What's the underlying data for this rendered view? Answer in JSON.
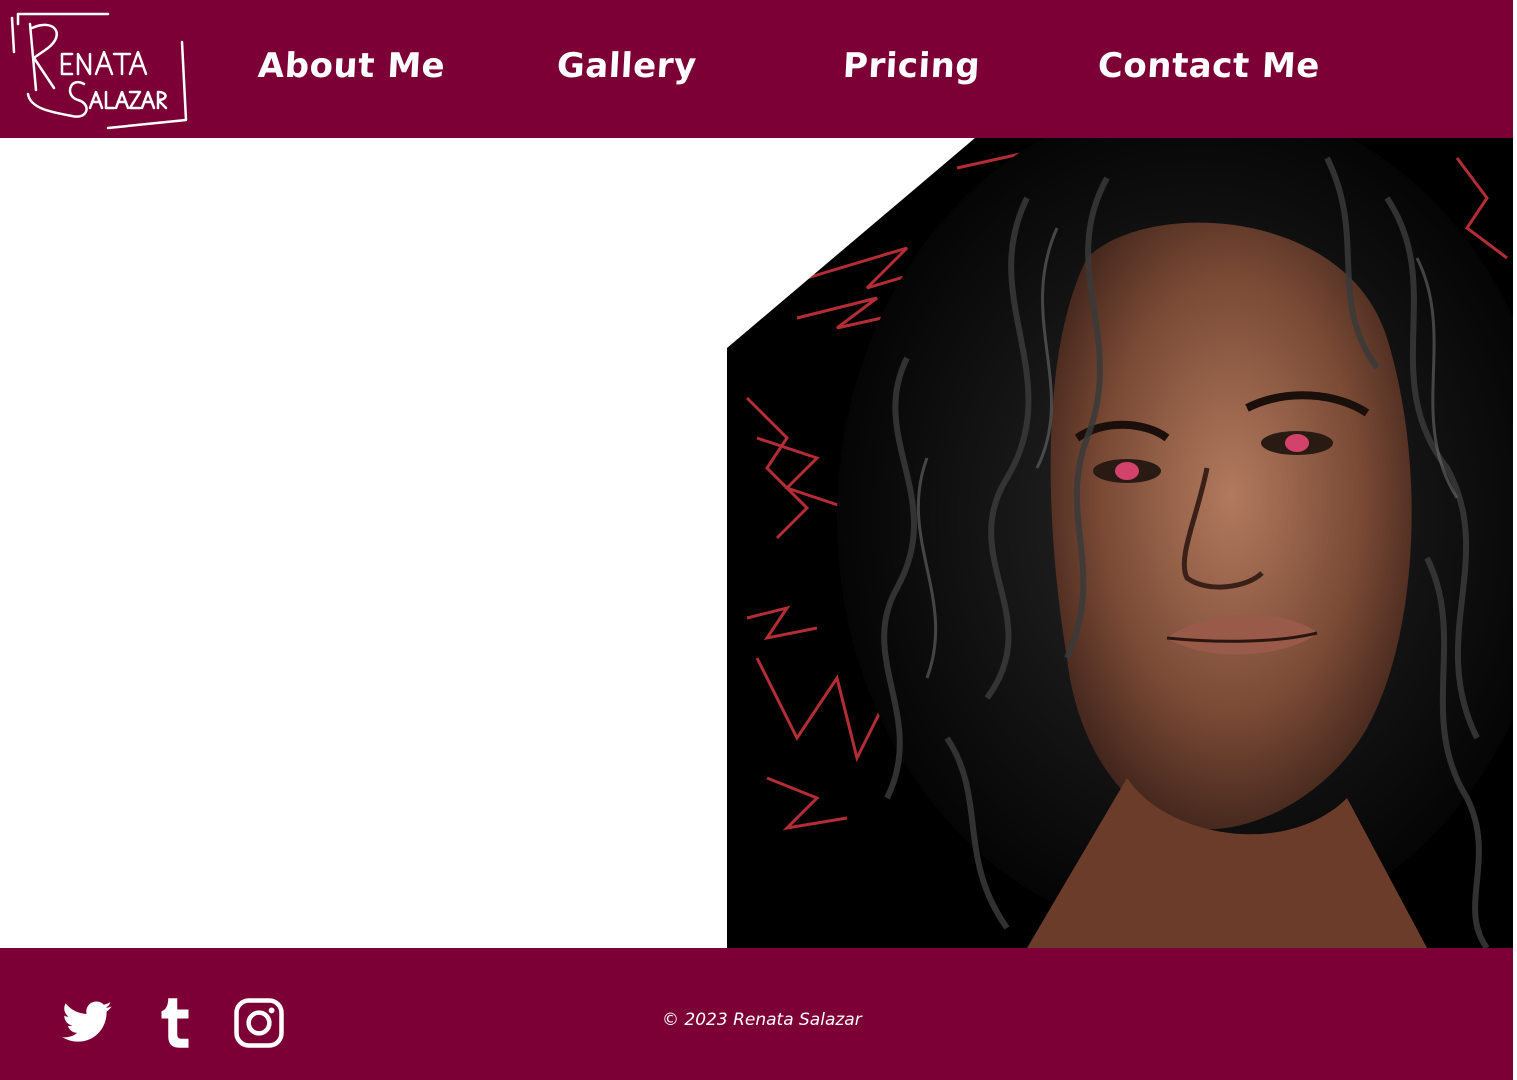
{
  "brand": {
    "logo_text_top": "RENATA",
    "logo_text_bottom": "SALAZAR",
    "color_primary": "#7c0035",
    "color_text": "#ffffff"
  },
  "nav": {
    "items": [
      {
        "label": "About Me"
      },
      {
        "label": "Gallery"
      },
      {
        "label": "Pricing"
      },
      {
        "label": "Contact Me"
      }
    ]
  },
  "hero": {
    "image": "portrait-painting"
  },
  "footer": {
    "social": [
      {
        "icon": "twitter-icon"
      },
      {
        "icon": "tumblr-icon"
      },
      {
        "icon": "instagram-icon"
      }
    ],
    "copyright": "© 2023 Renata Salazar"
  }
}
